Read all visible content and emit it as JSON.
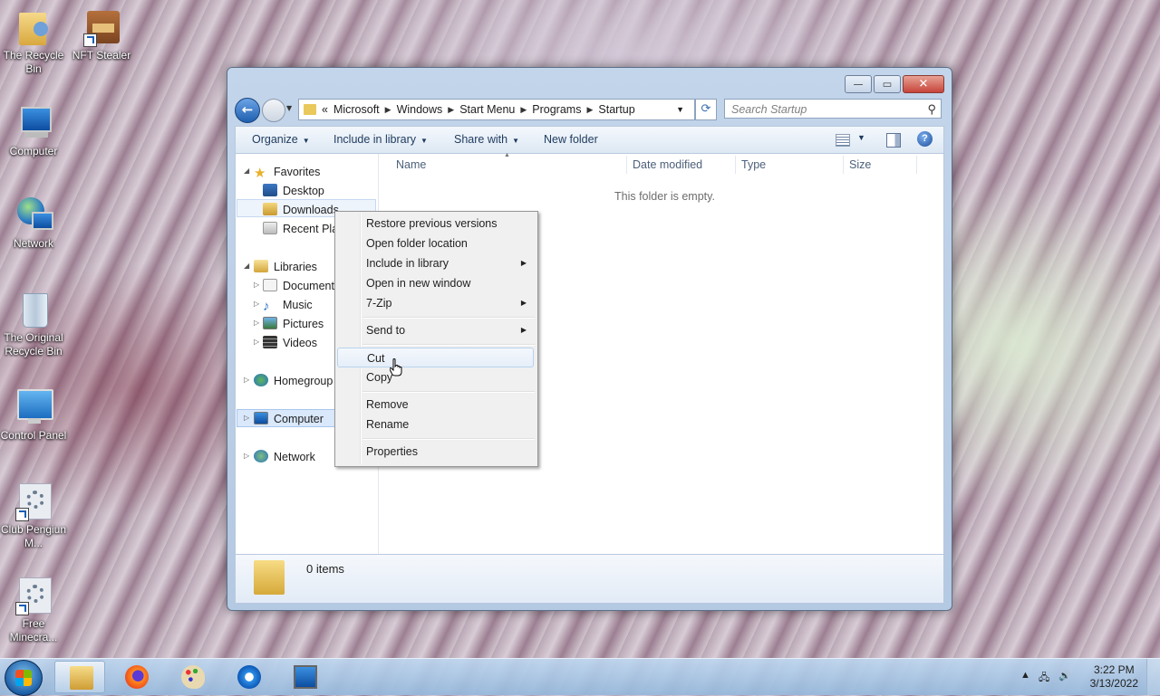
{
  "desktop": {
    "icons": [
      {
        "label": "The Recycle Bin",
        "icon": "folder-user-icon"
      },
      {
        "label": "NFT Stealer",
        "icon": "house-icon"
      },
      {
        "label": "Computer",
        "icon": "computer-icon"
      },
      {
        "label": "Network",
        "icon": "network-icon"
      },
      {
        "label": "The Original Recycle Bin",
        "icon": "recycle-bin-icon"
      },
      {
        "label": "Control Panel",
        "icon": "control-panel-icon"
      },
      {
        "label": "Club Pengiun M...",
        "icon": "setup-icon"
      },
      {
        "label": "Free Minecra...",
        "icon": "setup-icon"
      }
    ]
  },
  "window": {
    "controls": {
      "minimize": "—",
      "maximize": "▭",
      "close": "✕"
    },
    "address": {
      "overflow": "«",
      "segments": [
        "Microsoft",
        "Windows",
        "Start Menu",
        "Programs",
        "Startup"
      ]
    },
    "search": {
      "placeholder": "Search Startup"
    },
    "toolbar": {
      "organize": "Organize",
      "include_in_library": "Include in library",
      "share_with": "Share with",
      "new_folder": "New folder"
    },
    "nav": {
      "favorites": "Favorites",
      "desktop": "Desktop",
      "downloads": "Downloads",
      "recent_places": "Recent Plac",
      "libraries": "Libraries",
      "documents": "Documents",
      "music": "Music",
      "pictures": "Pictures",
      "videos": "Videos",
      "homegroup": "Homegroup",
      "computer": "Computer",
      "network": "Network"
    },
    "columns": [
      "Name",
      "Date modified",
      "Type",
      "Size"
    ],
    "empty_text": "This folder is empty.",
    "details": {
      "items": "0 items"
    }
  },
  "context_menu": {
    "items": [
      {
        "label": "Restore previous versions",
        "submenu": false
      },
      {
        "label": "Open folder location",
        "submenu": false
      },
      {
        "label": "Include in library",
        "submenu": true
      },
      {
        "label": "Open in new window",
        "submenu": false
      },
      {
        "label": "7-Zip",
        "submenu": true
      },
      {
        "label": "Send to",
        "submenu": true
      },
      {
        "label": "Cut",
        "submenu": false,
        "hovered": true
      },
      {
        "label": "Copy",
        "submenu": false
      },
      {
        "label": "Remove",
        "submenu": false
      },
      {
        "label": "Rename",
        "submenu": false
      },
      {
        "label": "Properties",
        "submenu": false
      }
    ]
  },
  "taskbar": {
    "buttons": [
      "windows-explorer",
      "firefox",
      "paint",
      "internet-explorer",
      "remote-desktop"
    ],
    "clock": {
      "time": "3:22 PM",
      "date": "3/13/2022"
    }
  }
}
